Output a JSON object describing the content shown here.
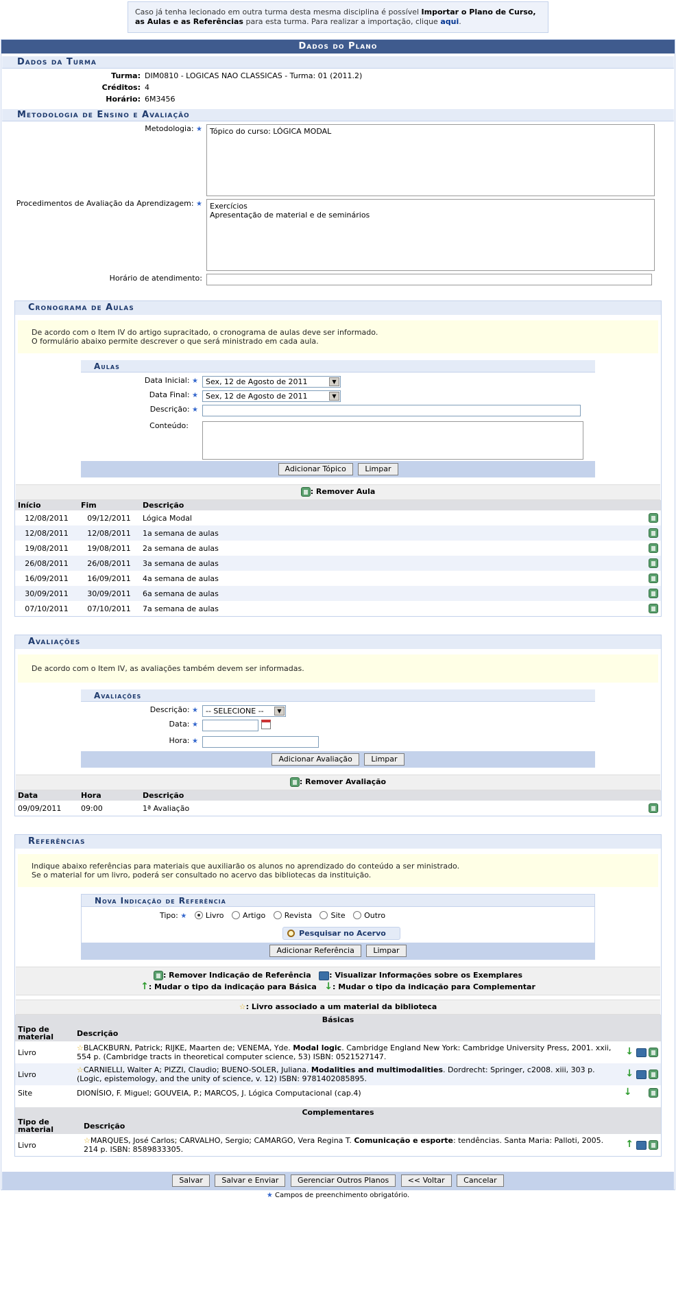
{
  "info": {
    "pre": "Caso já tenha lecionado em outra turma desta mesma disciplina é possível ",
    "bold": "Importar o Plano de Curso, as Aulas e as Referências",
    "post": " para esta turma. Para realizar a importação, clique ",
    "link": "aqui",
    "end": "."
  },
  "title": "Dados do Plano",
  "turma": {
    "section": "Dados da Turma",
    "turma_label": "Turma:",
    "turma_value": "DIM0810 - LOGICAS NAO CLASSICAS - Turma: 01 (2011.2)",
    "creditos_label": "Créditos:",
    "creditos_value": "4",
    "horario_label": "Horário:",
    "horario_value": "6M3456"
  },
  "metodologia": {
    "section": "Metodologia de Ensino e Avaliação",
    "metodologia_label": "Metodologia:",
    "metodologia_value": "Tópico do curso: LÓGICA MODAL",
    "procedimentos_label": "Procedimentos de Avaliação da Aprendizagem:",
    "procedimentos_line1": "Exercícios",
    "procedimentos_line2": "Apresentação de material e de seminários",
    "atendimento_label": "Horário de atendimento:"
  },
  "cronograma": {
    "title": "Cronograma de Aulas",
    "notice_line1": "De acordo com o Item IV do artigo supracitado, o cronograma de aulas deve ser informado.",
    "notice_line2": "O formulário abaixo permite descrever o que será ministrado em cada aula.",
    "aulas_title": "Aulas",
    "data_inicial_label": "Data Inicial:",
    "data_inicial_value": "Sex, 12 de Agosto de 2011",
    "data_final_label": "Data Final:",
    "data_final_value": "Sex, 12 de Agosto de 2011",
    "descricao_label": "Descrição:",
    "conteudo_label": "Conteúdo:",
    "btn_add": "Adicionar Tópico",
    "btn_clear": "Limpar",
    "legend": ": Remover Aula",
    "col_inicio": "Início",
    "col_fim": "Fim",
    "col_desc": "Descrição",
    "rows": [
      {
        "inicio": "12/08/2011",
        "fim": "09/12/2011",
        "desc": "Lógica Modal"
      },
      {
        "inicio": "12/08/2011",
        "fim": "12/08/2011",
        "desc": "1a semana de aulas"
      },
      {
        "inicio": "19/08/2011",
        "fim": "19/08/2011",
        "desc": "2a semana de aulas"
      },
      {
        "inicio": "26/08/2011",
        "fim": "26/08/2011",
        "desc": "3a semana de aulas"
      },
      {
        "inicio": "16/09/2011",
        "fim": "16/09/2011",
        "desc": "4a semana de aulas"
      },
      {
        "inicio": "30/09/2011",
        "fim": "30/09/2011",
        "desc": "6a semana de aulas"
      },
      {
        "inicio": "07/10/2011",
        "fim": "07/10/2011",
        "desc": "7a semana de aulas"
      }
    ]
  },
  "avaliacoes": {
    "title": "Avaliações",
    "notice": "De acordo com o Item IV, as avaliações também devem ser informadas.",
    "inner_title": "Avaliações",
    "descricao_label": "Descrição:",
    "descricao_value": "-- SELECIONE --",
    "data_label": "Data:",
    "hora_label": "Hora:",
    "btn_add": "Adicionar Avaliação",
    "btn_clear": "Limpar",
    "legend": ": Remover Avaliação",
    "col_data": "Data",
    "col_hora": "Hora",
    "col_desc": "Descrição",
    "rows": [
      {
        "data": "09/09/2011",
        "hora": "09:00",
        "desc": "1ª Avaliação"
      }
    ]
  },
  "referencias": {
    "title": "Referências",
    "notice_line1": "Indique abaixo referências para materiais que auxiliarão os alunos no aprendizado do conteúdo a ser ministrado.",
    "notice_line2": "Se o material for um livro, poderá ser consultado no acervo das bibliotecas da instituição.",
    "inner_title": "Nova Indicação de Referência",
    "tipo_label": "Tipo:",
    "tipos": [
      "Livro",
      "Artigo",
      "Revista",
      "Site",
      "Outro"
    ],
    "search_btn": "Pesquisar no Acervo",
    "btn_add": "Adicionar Referência",
    "btn_clear": "Limpar",
    "legend_remove": ": Remover Indicação de Referência",
    "legend_view": ": Visualizar Informações sobre os Exemplares",
    "legend_basica": ": Mudar o tipo da indicação para Básica",
    "legend_complementar": ": Mudar o tipo da indicação para Complementar",
    "legend_star": ": Livro associado a um material da biblioteca",
    "basicas_caption": "Básicas",
    "complementares_caption": "Complementares",
    "col_tipo": "Tipo de material",
    "col_desc": "Descrição",
    "basicas": [
      {
        "tipo": "Livro",
        "star": true,
        "pre": "BLACKBURN, Patrick; RIJKE, Maarten de; VENEMA, Yde. ",
        "bold": "Modal logic",
        "post": ". Cambridge England New York: Cambridge University Press, 2001. xxii, 554 p. (Cambridge tracts in theoretical computer science, 53) ISBN: 0521527147."
      },
      {
        "tipo": "Livro",
        "star": true,
        "pre": "CARNIELLI, Walter A; PIZZI, Claudio; BUENO-SOLER, Juliana. ",
        "bold": "Modalities and multimodalities",
        "post": ". Dordrecht: Springer, c2008. xiii, 303 p. (Logic, epistemology, and the unity of science, v. 12) ISBN: 9781402085895."
      },
      {
        "tipo": "Site",
        "star": false,
        "pre": "DIONÍSIO, F. Miguel; GOUVEIA, P.; MARCOS, J. Lógica Computacional (cap.4)",
        "bold": "",
        "post": ""
      }
    ],
    "complementares": [
      {
        "tipo": "Livro",
        "star": true,
        "pre": "MARQUES, José Carlos; CARVALHO, Sergio; CAMARGO, Vera Regina T. ",
        "bold": "Comunicação e esporte",
        "post": ": tendências. Santa Maria: Palloti, 2005. 214 p. ISBN: 8589833305."
      }
    ]
  },
  "footer": {
    "salvar": "Salvar",
    "salvar_enviar": "Salvar e Enviar",
    "gerenciar": "Gerenciar Outros Planos",
    "voltar": "<< Voltar",
    "cancelar": "Cancelar",
    "obrigatorio": "Campos de preenchimento obrigatório."
  },
  "icons": {
    "required": "asterisk-star-icon",
    "remove": "trash-icon",
    "view": "books-view-icon",
    "down": "arrow-down-icon",
    "up": "arrow-up-icon",
    "star": "star-icon",
    "search": "magnifier-icon",
    "calendar": "calendar-icon"
  },
  "colors": {
    "header_bg": "#3F5B8E",
    "subtitle_bg": "#E4EBF7",
    "notice_bg": "#FFFFE6",
    "button_bar": "#C4D2EB"
  }
}
